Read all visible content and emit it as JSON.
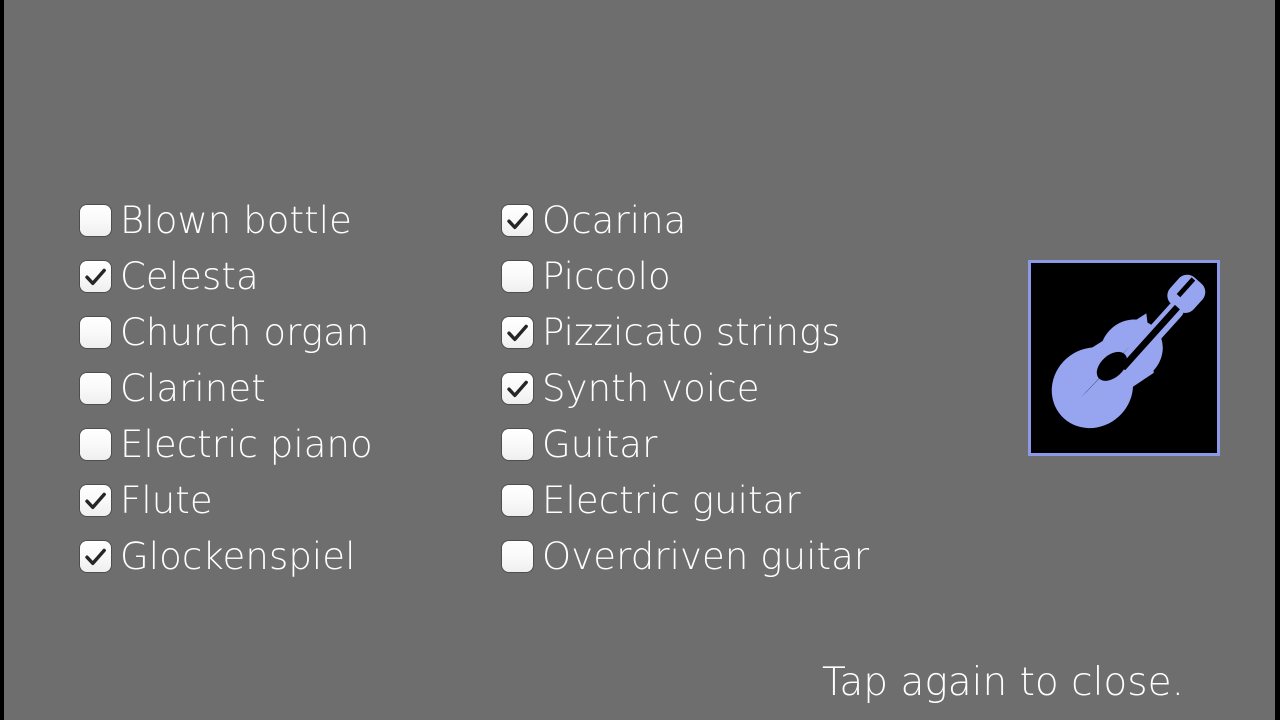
{
  "screen": {
    "background_color": "#6e6e6e",
    "text_color": "#ffffff",
    "edge_border_color": "#000000"
  },
  "instrument_list": {
    "columns": [
      {
        "name": "left-column",
        "items": [
          {
            "label": "Blown bottle",
            "checked": false
          },
          {
            "label": "Celesta",
            "checked": true
          },
          {
            "label": "Church organ",
            "checked": false
          },
          {
            "label": "Clarinet",
            "checked": false
          },
          {
            "label": "Electric piano",
            "checked": false
          },
          {
            "label": "Flute",
            "checked": true
          },
          {
            "label": "Glockenspiel",
            "checked": true
          }
        ]
      },
      {
        "name": "right-column",
        "items": [
          {
            "label": "Ocarina",
            "checked": true
          },
          {
            "label": "Piccolo",
            "checked": false
          },
          {
            "label": "Pizzicato strings",
            "checked": true
          },
          {
            "label": "Synth voice",
            "checked": true
          },
          {
            "label": "Guitar",
            "checked": false
          },
          {
            "label": "Electric guitar",
            "checked": false
          },
          {
            "label": "Overdriven guitar",
            "checked": false
          }
        ]
      }
    ]
  },
  "instrument_icon": {
    "icon_name": "acoustic-guitar-icon",
    "glyph_color": "#97a5f0",
    "panel_background": "#000000",
    "panel_border_color": "#8b9ae8"
  },
  "footer": {
    "close_hint": "Tap again to close."
  }
}
